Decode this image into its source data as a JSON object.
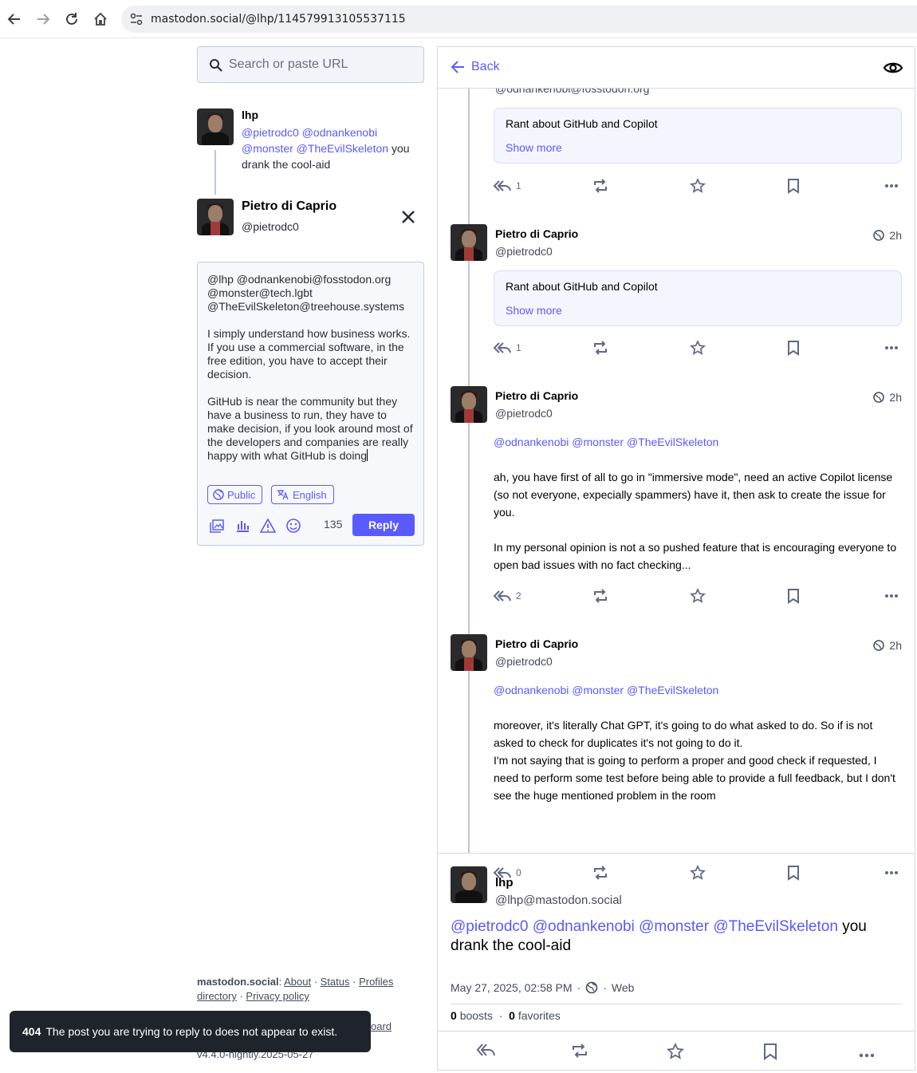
{
  "browser": {
    "url": "mastodon.social/@lhp/114579913105537115"
  },
  "search": {
    "placeholder": "Search or paste URL"
  },
  "reply_context": {
    "name": "lhp",
    "mentions": "@pietrodc0 @odnankenobi @monster @TheEvilSkeleton",
    "text": "you drank the cool-aid"
  },
  "composer": {
    "author_name": "Pietro di Caprio",
    "author_handle": "@pietrodc0",
    "text": "@lhp @odnankenobi@fosstodon.org\n@monster@tech.lgbt\n@TheEvilSkeleton@treehouse.systems\n\nI simply understand how business works. If you use a commercial software, in the free edition, you have to accept their decision.\n\nGitHub is near the community but they have a business to run, they have to make decision, if you look around most of the developers and companies are really happy with what GitHub is doing",
    "visibility": "Public",
    "language": "English",
    "char_count": "135",
    "reply_label": "Reply"
  },
  "footer": {
    "server": "mastodon.social",
    "links": [
      "About",
      "Status",
      "Profiles directory",
      "Privacy policy"
    ],
    "dashboard_fragment": "oard",
    "version": "v4.4.0-nightly.2025-05-27"
  },
  "toast": {
    "code": "404",
    "message": "The post you are trying to reply to does not appear to exist."
  },
  "column": {
    "back_label": "Back",
    "top_handle": "@odnankenobi@fosstodon.org",
    "first_cw": {
      "title": "Rant about GitHub and Copilot",
      "more": "Show more",
      "replies": "1"
    },
    "statuses": [
      {
        "name": "Pietro di Caprio",
        "handle": "@pietrodc0",
        "time": "2h",
        "cw_title": "Rant about GitHub and Copilot",
        "cw_more": "Show more",
        "replies": "1"
      },
      {
        "name": "Pietro di Caprio",
        "handle": "@pietrodc0",
        "time": "2h",
        "mentions": "@odnankenobi @monster @TheEvilSkeleton",
        "para1": "ah, you have first of all to go in \"immersive mode\", need an active Copilot license (so not everyone, expecially spammers) have it, then ask to create the issue for you.",
        "para2": "In my personal opinion is not a so pushed feature that is encouraging everyone to open bad issues with no fact checking...",
        "replies": "2"
      },
      {
        "name": "Pietro di Caprio",
        "handle": "@pietrodc0",
        "time": "2h",
        "mentions": "@odnankenobi @monster @TheEvilSkeleton",
        "para1": "moreover, it's literally Chat GPT, it's going to do what asked to do. So if is not asked to check for duplicates it's not going to do it.\nI'm not saying that is going to perform a proper and good check if requested, I need to perform some test before being able to provide a full feedback, but I don't see the huge mentioned problem in the room",
        "replies": "0"
      }
    ],
    "focused": {
      "name": "lhp",
      "handle": "@lhp@mastodon.social",
      "mentions": "@pietrodc0 @odnankenobi @monster @TheEvilSkeleton",
      "text": "you drank the cool-aid",
      "date": "May 27, 2025, 02:58 PM",
      "app": "Web",
      "boosts": "0",
      "boosts_label": "boosts",
      "favorites": "0",
      "favorites_label": "favorites"
    }
  },
  "colors": {
    "accent": "#595aff",
    "toast_bg": "#1f232b",
    "border": "#d6d9e6"
  }
}
